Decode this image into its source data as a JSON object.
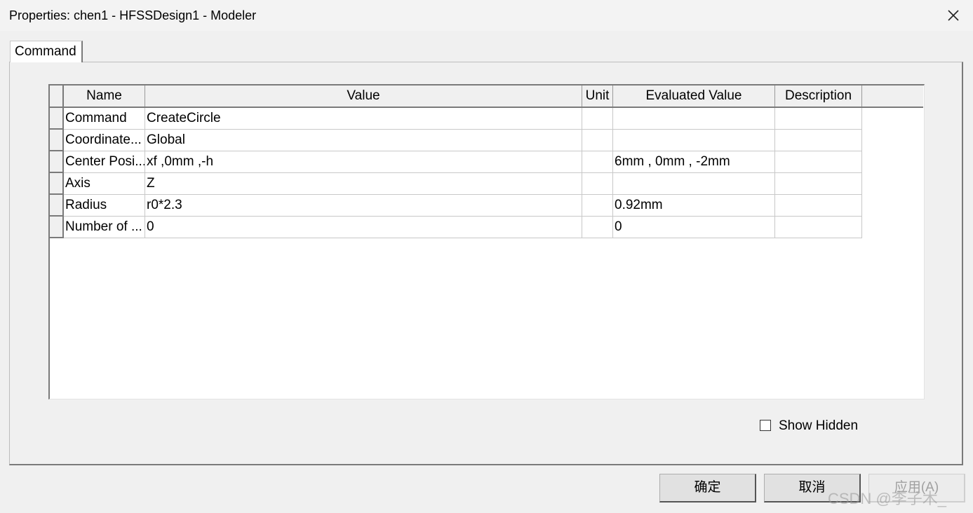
{
  "window": {
    "title": "Properties: chen1 - HFSSDesign1 - Modeler"
  },
  "tabs": [
    {
      "label": "Command"
    }
  ],
  "table": {
    "columns": [
      "Name",
      "Value",
      "Unit",
      "Evaluated Value",
      "Description"
    ],
    "rows": [
      {
        "name": "Command",
        "value": "CreateCircle",
        "unit": "",
        "evaluated": "",
        "description": ""
      },
      {
        "name": "Coordinate...",
        "value": "Global",
        "unit": "",
        "evaluated": "",
        "description": ""
      },
      {
        "name": "Center Posi...",
        "value": "xf ,0mm ,-h",
        "unit": "",
        "evaluated": "6mm , 0mm , -2mm",
        "description": ""
      },
      {
        "name": "Axis",
        "value": "Z",
        "unit": "",
        "evaluated": "",
        "description": ""
      },
      {
        "name": "Radius",
        "value": "r0*2.3",
        "unit": "",
        "evaluated": "0.92mm",
        "description": ""
      },
      {
        "name": "Number of ...",
        "value": "0",
        "unit": "",
        "evaluated": "0",
        "description": ""
      }
    ]
  },
  "show_hidden": {
    "label": "Show Hidden",
    "checked": false
  },
  "buttons": {
    "ok": "确定",
    "cancel": "取消",
    "apply": "应用(A)"
  },
  "watermark": "CSDN @李子木_"
}
